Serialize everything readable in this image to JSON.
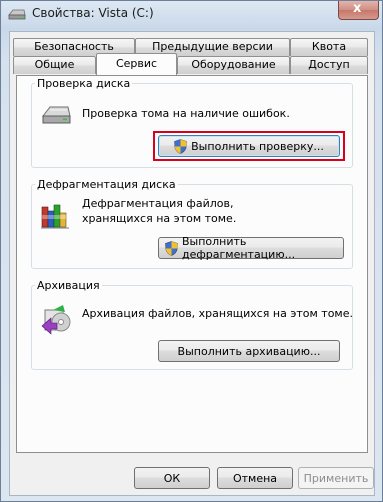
{
  "window": {
    "title": "Свойства: Vista (C:)",
    "close_glyph": "x"
  },
  "tabs": {
    "row1": [
      "Безопасность",
      "Предыдущие версии",
      "Квота"
    ],
    "row2": [
      "Общие",
      "Сервис",
      "Оборудование",
      "Доступ"
    ],
    "active": "Сервис"
  },
  "groups": {
    "check": {
      "title": "Проверка диска",
      "description": "Проверка тома на наличие ошибок.",
      "button": "Выполнить проверку...",
      "icon": "disk-drive-icon"
    },
    "defrag": {
      "title": "Дефрагментация диска",
      "description": "Дефрагментация файлов, хранящихся на этом томе.",
      "button": "Выполнить дефрагментацию...",
      "icon": "defrag-icon"
    },
    "backup": {
      "title": "Архивация",
      "description": "Архивация файлов, хранящихся на этом томе.",
      "button": "Выполнить архивацию...",
      "icon": "backup-icon"
    }
  },
  "footer": {
    "ok": "ОК",
    "cancel": "Отмена",
    "apply": "Применить"
  },
  "colors": {
    "highlight": "#d8001c",
    "panel": "#fcfcfc",
    "window": "#d6e1ee"
  }
}
